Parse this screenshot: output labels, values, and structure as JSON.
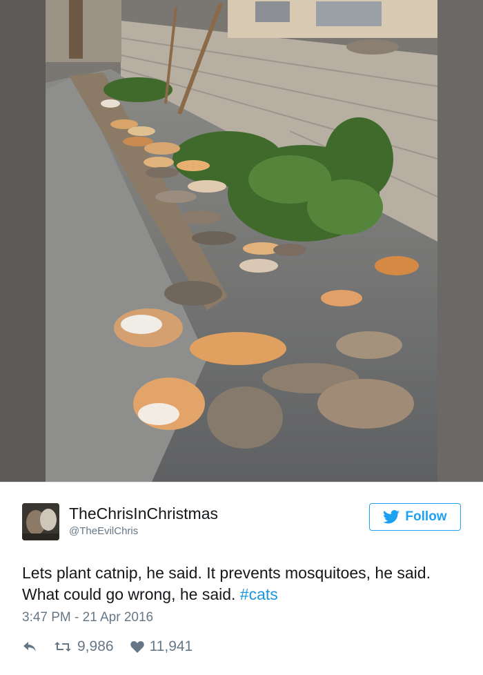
{
  "photo": {
    "subject": "cats-lying-on-sidewalk"
  },
  "tweet": {
    "display_name": "TheChrisInChristmas",
    "handle": "@TheEvilChris",
    "follow_label": "Follow",
    "text_main": "Lets plant catnip, he said. It prevents mosquitoes, he said. What could go wrong, he said. ",
    "hashtag": "#cats",
    "timestamp": "3:47 PM - 21 Apr 2016",
    "retweets": "9,986",
    "likes": "11,941"
  },
  "colors": {
    "twitter_blue": "#1da1f2",
    "hashtag_blue": "#1b95e0",
    "secondary_text": "#657786"
  },
  "icons": {
    "follow": "bird-icon",
    "reply": "reply-icon",
    "retweet": "retweet-icon",
    "like": "heart-icon"
  }
}
